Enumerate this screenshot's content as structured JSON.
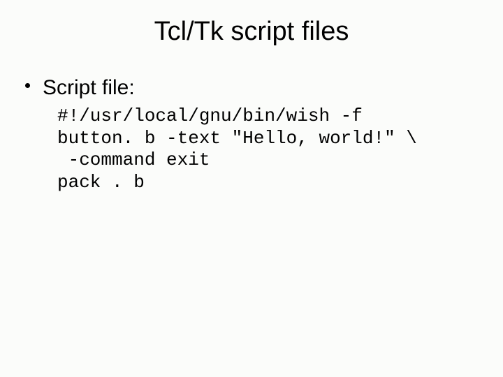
{
  "title": "Tcl/Tk script files",
  "bullet": "Script file:",
  "code": {
    "line1": "#!/usr/local/gnu/bin/wish -f",
    "line2": "button. b -text \"Hello, world!\" \\",
    "line3": " -command exit",
    "line4": "pack . b"
  }
}
